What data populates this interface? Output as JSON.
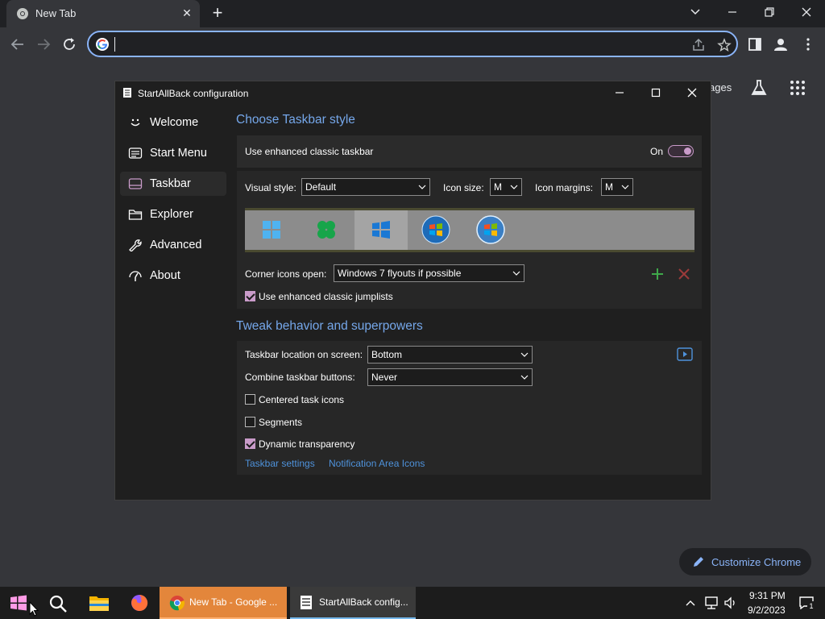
{
  "chrome": {
    "tab_title": "New Tab",
    "omnibox_value": "",
    "ntp_images_label": "ages",
    "customize_label": "Customize Chrome"
  },
  "dialog": {
    "title": "StartAllBack configuration",
    "nav": [
      {
        "label": "Welcome",
        "icon": "smiley-icon"
      },
      {
        "label": "Start Menu",
        "icon": "start-menu-icon"
      },
      {
        "label": "Taskbar",
        "icon": "taskbar-icon",
        "active": true
      },
      {
        "label": "Explorer",
        "icon": "folder-icon"
      },
      {
        "label": "Advanced",
        "icon": "wrench-icon"
      },
      {
        "label": "About",
        "icon": "info-icon"
      }
    ],
    "section1": {
      "title": "Choose Taskbar style",
      "enhanced_label": "Use enhanced classic taskbar",
      "enhanced_state": "On",
      "visual_style_label": "Visual style:",
      "visual_style_value": "Default",
      "icon_size_label": "Icon size:",
      "icon_size_value": "M",
      "icon_margins_label": "Icon margins:",
      "icon_margins_value": "M",
      "corner_label": "Corner icons open:",
      "corner_value": "Windows 7 flyouts if possible",
      "jumplists_label": "Use enhanced classic jumplists",
      "jumplists_checked": true
    },
    "section2": {
      "title": "Tweak behavior and superpowers",
      "location_label": "Taskbar location on screen:",
      "location_value": "Bottom",
      "combine_label": "Combine taskbar buttons:",
      "combine_value": "Never",
      "centered_label": "Centered task icons",
      "centered_checked": false,
      "segments_label": "Segments",
      "segments_checked": false,
      "dynamic_label": "Dynamic transparency",
      "dynamic_checked": true,
      "link_taskbar_settings": "Taskbar settings",
      "link_notification_icons": "Notification Area Icons"
    }
  },
  "taskbar": {
    "chrome_label": "New Tab - Google ...",
    "sab_label": "StartAllBack config...",
    "time": "9:31 PM",
    "date": "9/2/2023",
    "notification_count": "1"
  },
  "colors": {
    "accent_link": "#75a7ea",
    "toggle_accent": "#c99bc9",
    "omnibox_border": "#8ab4f8"
  }
}
